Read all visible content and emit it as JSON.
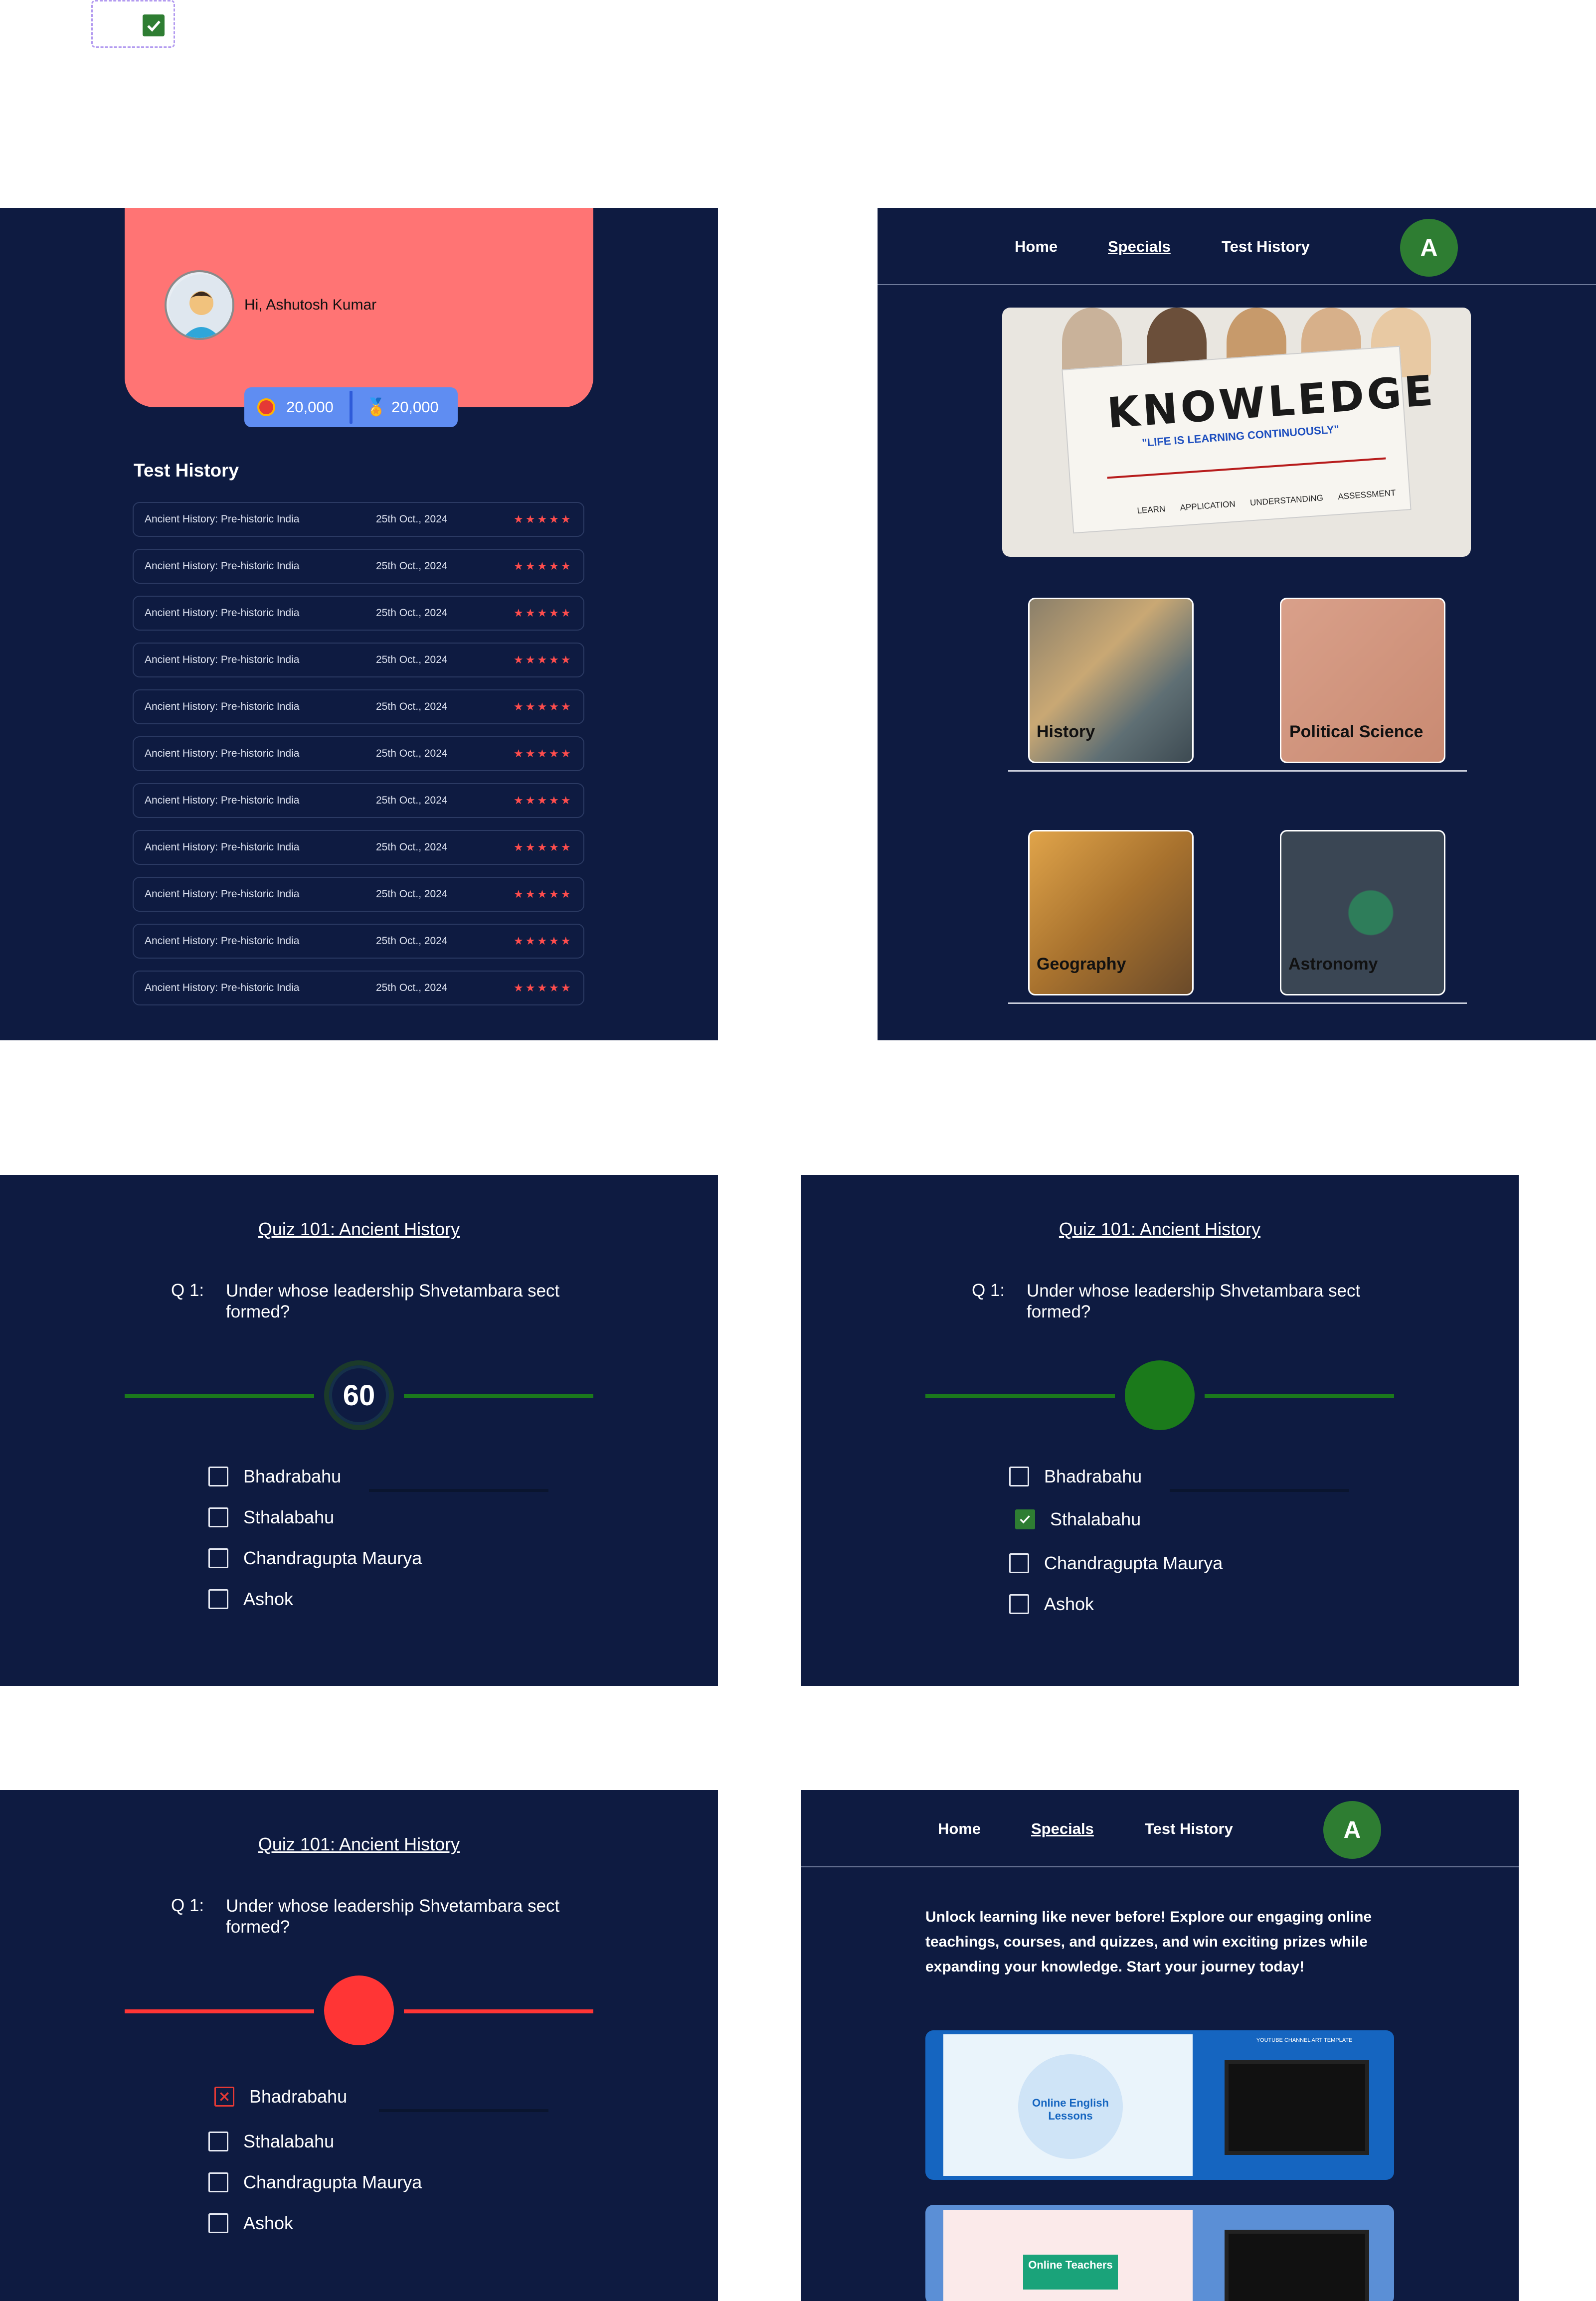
{
  "component": {
    "checkbox": "checked"
  },
  "profile": {
    "greeting": "Hi, Ashutosh Kumar",
    "coins": "20,000",
    "medals": "20,000",
    "history_title": "Test History",
    "history": [
      {
        "name": "Ancient History: Pre-historic India",
        "date": "25th Oct., 2024",
        "stars": "★★★★★"
      },
      {
        "name": "Ancient History: Pre-historic India",
        "date": "25th Oct., 2024",
        "stars": "★★★★★"
      },
      {
        "name": "Ancient History: Pre-historic India",
        "date": "25th Oct., 2024",
        "stars": "★★★★★"
      },
      {
        "name": "Ancient History: Pre-historic India",
        "date": "25th Oct., 2024",
        "stars": "★★★★★"
      },
      {
        "name": "Ancient History: Pre-historic India",
        "date": "25th Oct., 2024",
        "stars": "★★★★★"
      },
      {
        "name": "Ancient History: Pre-historic India",
        "date": "25th Oct., 2024",
        "stars": "★★★★★"
      },
      {
        "name": "Ancient History: Pre-historic India",
        "date": "25th Oct., 2024",
        "stars": "★★★★★"
      },
      {
        "name": "Ancient History: Pre-historic India",
        "date": "25th Oct., 2024",
        "stars": "★★★★★"
      },
      {
        "name": "Ancient History: Pre-historic India",
        "date": "25th Oct., 2024",
        "stars": "★★★★★"
      },
      {
        "name": "Ancient History: Pre-historic India",
        "date": "25th Oct., 2024",
        "stars": "★★★★★"
      },
      {
        "name": "Ancient History: Pre-historic India",
        "date": "25th Oct., 2024",
        "stars": "★★★★★"
      }
    ]
  },
  "nav": {
    "home": "Home",
    "specials": "Specials",
    "history": "Test History",
    "avatar": "A"
  },
  "specials": {
    "hero": {
      "word": "KNOWLEDGE",
      "tagline": "\"LIFE IS LEARNING CONTINUOUSLY\"",
      "steps": [
        "LEARN",
        "APPLICATION",
        "UNDERSTANDING",
        "ASSESSMENT"
      ]
    },
    "topics": [
      "History",
      "Political Science",
      "Geography",
      "Astronomy"
    ]
  },
  "quiz": {
    "title": "Quiz 101: Ancient History",
    "qnum": "Q 1:",
    "question": "Under whose leadership Shvetambara sect formed?",
    "timer": "60",
    "options": [
      "Bhadrabahu",
      "Sthalabahu",
      "Chandragupta Maurya",
      "Ashok"
    ]
  },
  "colors": {
    "bg": "#0e1b41",
    "correct": "#1b7a1b",
    "wrong": "#ff3535",
    "accent": "#ff7474"
  },
  "landing": {
    "intro": "Unlock learning like never before! Explore our engaging online teachings, courses, and quizzes, and win exciting prizes while expanding your knowledge. Start your journey today!",
    "banner1": {
      "title": "Online English Lessons",
      "caption": "YOUTUBE CHANNEL ART TEMPLATE"
    },
    "banner2": {
      "title": "Online Teachers"
    }
  }
}
